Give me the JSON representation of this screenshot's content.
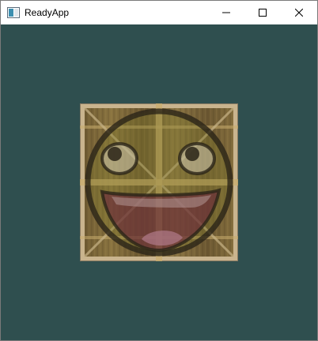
{
  "window": {
    "title": "ReadyApp",
    "client_background": "#2f4f4f",
    "controls": [
      "minimize-icon",
      "maximize-icon",
      "close-icon"
    ]
  },
  "scene": {
    "object": "textured-quad",
    "textures": [
      "wooden-crate",
      "awesome-face"
    ],
    "blend": "mix"
  }
}
